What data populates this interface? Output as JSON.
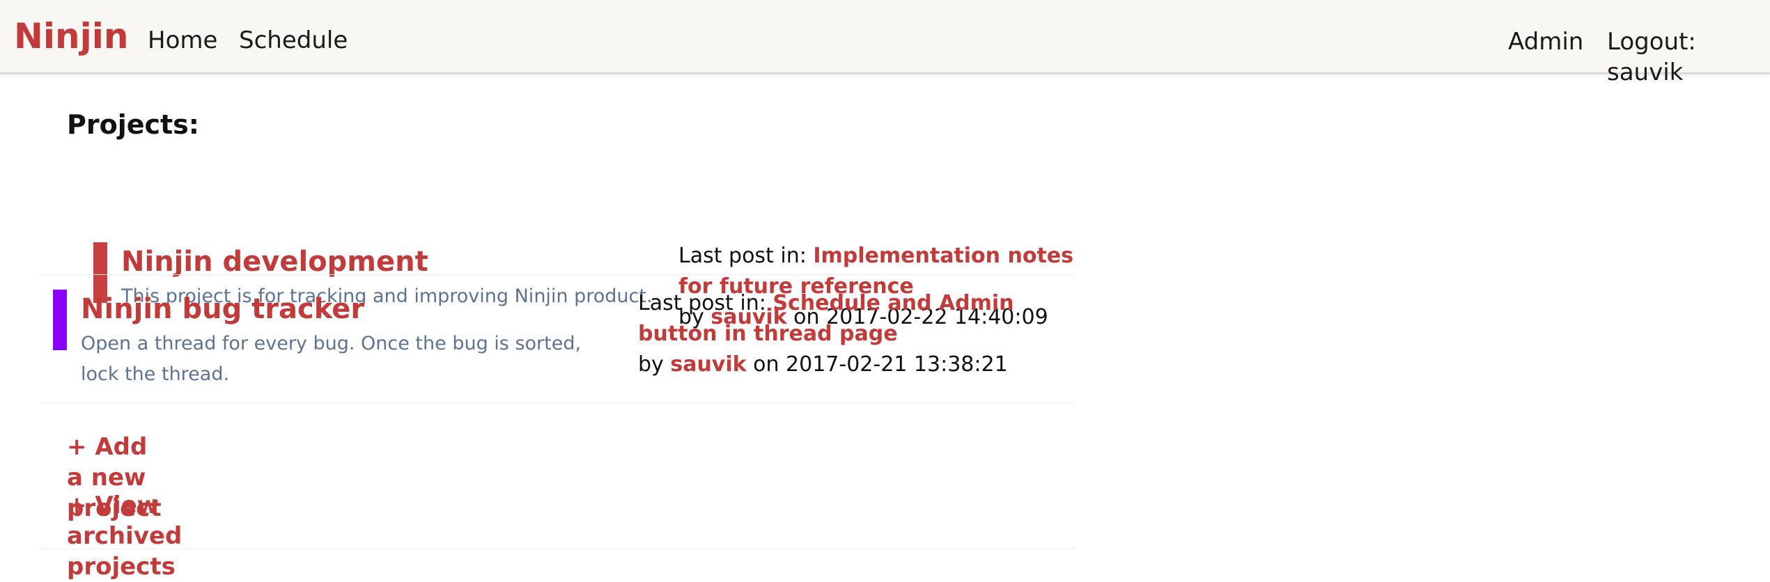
{
  "navbar": {
    "brand": "Ninjin",
    "home": "Home",
    "schedule": "Schedule",
    "admin": "Admin",
    "logout": "Logout: sauvik"
  },
  "page": {
    "title": "Projects:"
  },
  "projects": [
    {
      "name": "Ninjin development",
      "description": "This project is for tracking and improving Ninjin product.",
      "color": "#c94040",
      "last_post_prefix": "Last post in: ",
      "last_post_title": "Implementation notes for future reference",
      "by_prefix": "by ",
      "author": "sauvik",
      "on_prefix": " on ",
      "timestamp": "2017-02-22 14:40:09"
    },
    {
      "name": "Ninjin bug tracker",
      "description": "Open a thread for every bug. Once the bug is sorted, lock the thread.",
      "color": "#8a00ff",
      "last_post_prefix": "Last post in: ",
      "last_post_title": "Schedule and Admin button in thread page",
      "by_prefix": "by ",
      "author": "sauvik",
      "on_prefix": " on ",
      "timestamp": "2017-02-21 13:38:21"
    }
  ],
  "actions": {
    "add_project": "+ Add a new project",
    "view_archived": "+ View archived projects"
  }
}
